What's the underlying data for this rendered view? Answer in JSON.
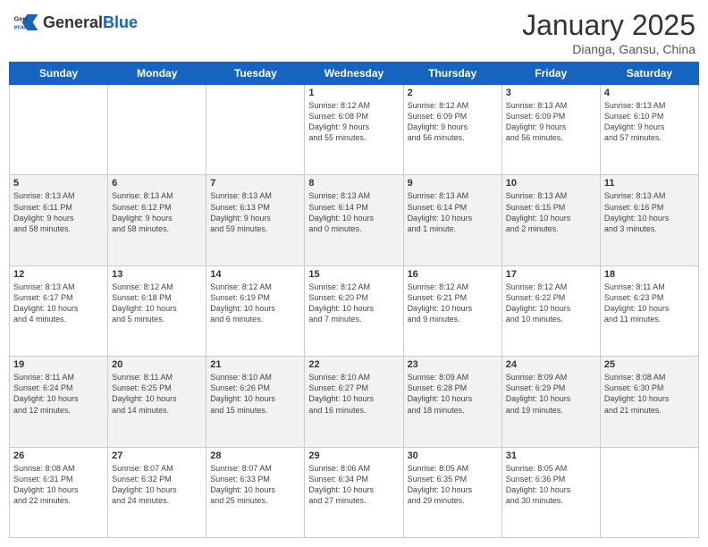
{
  "header": {
    "logo_general": "General",
    "logo_blue": "Blue",
    "month_title": "January 2025",
    "subtitle": "Dianga, Gansu, China"
  },
  "weekdays": [
    "Sunday",
    "Monday",
    "Tuesday",
    "Wednesday",
    "Thursday",
    "Friday",
    "Saturday"
  ],
  "weeks": [
    [
      {
        "day": "",
        "info": ""
      },
      {
        "day": "",
        "info": ""
      },
      {
        "day": "",
        "info": ""
      },
      {
        "day": "1",
        "info": "Sunrise: 8:12 AM\nSunset: 6:08 PM\nDaylight: 9 hours\nand 55 minutes."
      },
      {
        "day": "2",
        "info": "Sunrise: 8:12 AM\nSunset: 6:09 PM\nDaylight: 9 hours\nand 56 minutes."
      },
      {
        "day": "3",
        "info": "Sunrise: 8:13 AM\nSunset: 6:09 PM\nDaylight: 9 hours\nand 56 minutes."
      },
      {
        "day": "4",
        "info": "Sunrise: 8:13 AM\nSunset: 6:10 PM\nDaylight: 9 hours\nand 57 minutes."
      }
    ],
    [
      {
        "day": "5",
        "info": "Sunrise: 8:13 AM\nSunset: 6:11 PM\nDaylight: 9 hours\nand 58 minutes."
      },
      {
        "day": "6",
        "info": "Sunrise: 8:13 AM\nSunset: 6:12 PM\nDaylight: 9 hours\nand 58 minutes."
      },
      {
        "day": "7",
        "info": "Sunrise: 8:13 AM\nSunset: 6:13 PM\nDaylight: 9 hours\nand 59 minutes."
      },
      {
        "day": "8",
        "info": "Sunrise: 8:13 AM\nSunset: 6:14 PM\nDaylight: 10 hours\nand 0 minutes."
      },
      {
        "day": "9",
        "info": "Sunrise: 8:13 AM\nSunset: 6:14 PM\nDaylight: 10 hours\nand 1 minute."
      },
      {
        "day": "10",
        "info": "Sunrise: 8:13 AM\nSunset: 6:15 PM\nDaylight: 10 hours\nand 2 minutes."
      },
      {
        "day": "11",
        "info": "Sunrise: 8:13 AM\nSunset: 6:16 PM\nDaylight: 10 hours\nand 3 minutes."
      }
    ],
    [
      {
        "day": "12",
        "info": "Sunrise: 8:13 AM\nSunset: 6:17 PM\nDaylight: 10 hours\nand 4 minutes."
      },
      {
        "day": "13",
        "info": "Sunrise: 8:12 AM\nSunset: 6:18 PM\nDaylight: 10 hours\nand 5 minutes."
      },
      {
        "day": "14",
        "info": "Sunrise: 8:12 AM\nSunset: 6:19 PM\nDaylight: 10 hours\nand 6 minutes."
      },
      {
        "day": "15",
        "info": "Sunrise: 8:12 AM\nSunset: 6:20 PM\nDaylight: 10 hours\nand 7 minutes."
      },
      {
        "day": "16",
        "info": "Sunrise: 8:12 AM\nSunset: 6:21 PM\nDaylight: 10 hours\nand 9 minutes."
      },
      {
        "day": "17",
        "info": "Sunrise: 8:12 AM\nSunset: 6:22 PM\nDaylight: 10 hours\nand 10 minutes."
      },
      {
        "day": "18",
        "info": "Sunrise: 8:11 AM\nSunset: 6:23 PM\nDaylight: 10 hours\nand 11 minutes."
      }
    ],
    [
      {
        "day": "19",
        "info": "Sunrise: 8:11 AM\nSunset: 6:24 PM\nDaylight: 10 hours\nand 12 minutes."
      },
      {
        "day": "20",
        "info": "Sunrise: 8:11 AM\nSunset: 6:25 PM\nDaylight: 10 hours\nand 14 minutes."
      },
      {
        "day": "21",
        "info": "Sunrise: 8:10 AM\nSunset: 6:26 PM\nDaylight: 10 hours\nand 15 minutes."
      },
      {
        "day": "22",
        "info": "Sunrise: 8:10 AM\nSunset: 6:27 PM\nDaylight: 10 hours\nand 16 minutes."
      },
      {
        "day": "23",
        "info": "Sunrise: 8:09 AM\nSunset: 6:28 PM\nDaylight: 10 hours\nand 18 minutes."
      },
      {
        "day": "24",
        "info": "Sunrise: 8:09 AM\nSunset: 6:29 PM\nDaylight: 10 hours\nand 19 minutes."
      },
      {
        "day": "25",
        "info": "Sunrise: 8:08 AM\nSunset: 6:30 PM\nDaylight: 10 hours\nand 21 minutes."
      }
    ],
    [
      {
        "day": "26",
        "info": "Sunrise: 8:08 AM\nSunset: 6:31 PM\nDaylight: 10 hours\nand 22 minutes."
      },
      {
        "day": "27",
        "info": "Sunrise: 8:07 AM\nSunset: 6:32 PM\nDaylight: 10 hours\nand 24 minutes."
      },
      {
        "day": "28",
        "info": "Sunrise: 8:07 AM\nSunset: 6:33 PM\nDaylight: 10 hours\nand 25 minutes."
      },
      {
        "day": "29",
        "info": "Sunrise: 8:06 AM\nSunset: 6:34 PM\nDaylight: 10 hours\nand 27 minutes."
      },
      {
        "day": "30",
        "info": "Sunrise: 8:05 AM\nSunset: 6:35 PM\nDaylight: 10 hours\nand 29 minutes."
      },
      {
        "day": "31",
        "info": "Sunrise: 8:05 AM\nSunset: 6:36 PM\nDaylight: 10 hours\nand 30 minutes."
      },
      {
        "day": "",
        "info": ""
      }
    ]
  ]
}
